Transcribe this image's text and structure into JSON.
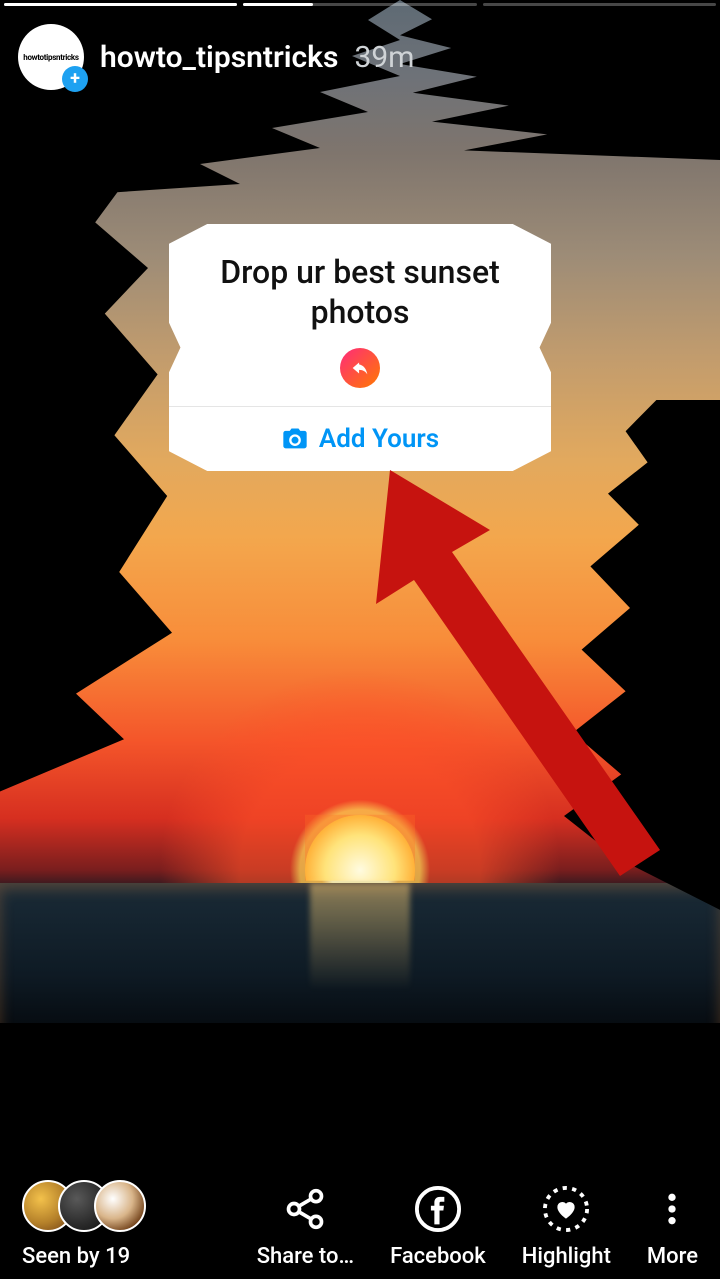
{
  "header": {
    "username": "howto_tipsntricks",
    "time": "39m",
    "avatar_text": "howtotipsntricks"
  },
  "progress": {
    "segments": 3,
    "current_index": 1,
    "current_fill_pct": 30
  },
  "sticker": {
    "prompt": "Drop ur best sunset photos",
    "add_label": "Add Yours"
  },
  "bottom": {
    "seen_label": "Seen by 19",
    "share_label": "Share to…",
    "facebook_label": "Facebook",
    "highlight_label": "Highlight",
    "more_label": "More"
  },
  "colors": {
    "accent_blue": "#0095f6",
    "brand_gradient_from": "#ff2a7b",
    "brand_gradient_to": "#ff7a00",
    "annotation_red": "#c6130f"
  }
}
